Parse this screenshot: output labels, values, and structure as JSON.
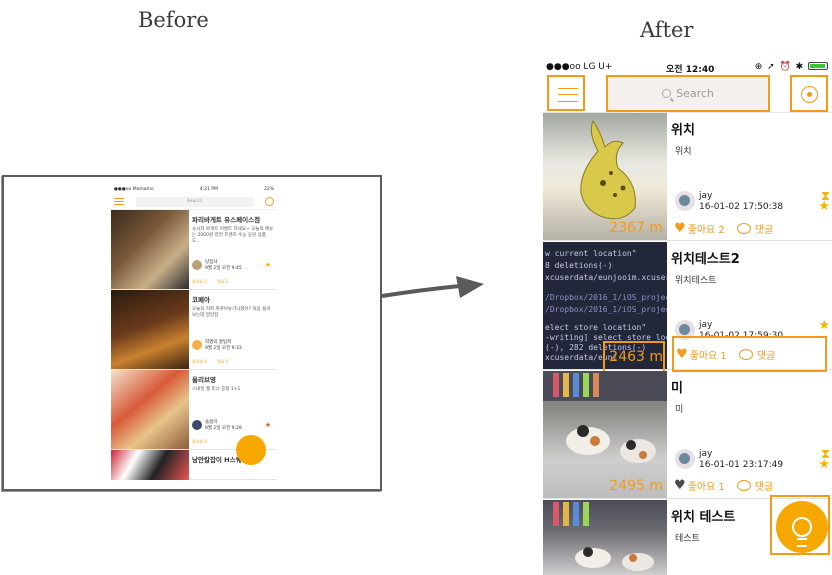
{
  "captions": {
    "before": "Before",
    "after": "After"
  },
  "before": {
    "status": {
      "carrier": "●●●oo Mamamo",
      "time": "4:21 PM",
      "battery": "22%"
    },
    "search_placeholder": "Search",
    "items": [
      {
        "title": "파리바게트 유스페이스점",
        "desc": "소시지 바게트 이벤트 하네요~ 오늘의 메뉴는 2000원 라떤 프렌즈 수능 응원 상품도...",
        "user": "냥집사",
        "date": "9월 2일 오전 9:45",
        "like": "좋아요 2",
        "comment": "댓글 1"
      },
      {
        "title": "코페아",
        "desc": "오늘의 커피 파푸아뉴기니였어? 처음 들어보는데 달달함",
        "user": "익명의 꿀팁퍼",
        "date": "9월 2일 오전 9:33",
        "like": "좋아요 4",
        "comment": "댓글 0"
      },
      {
        "title": "올리브영",
        "desc": "스네일 젤 토너 증정 1+1",
        "user": "솔몸이",
        "date": "9월 2일 오전 9:29",
        "like": "좋아요 3",
        "comment": ""
      },
      {
        "title": "낭만칼잡이 H스퀘어",
        "desc": "",
        "user": "",
        "date": "",
        "like": "",
        "comment": ""
      }
    ]
  },
  "after": {
    "status": {
      "carrier": "●●●oo LG U+",
      "time": "오전 12:40",
      "icons": "⊕ ➚ ⏰ ✱"
    },
    "search_placeholder": "Search",
    "items": [
      {
        "title": "위치",
        "desc": "위치",
        "distance": "2367 m",
        "user": "jay",
        "datetime": "16-01-02 17:50:38",
        "like": "좋아요 2",
        "comment": "댓글",
        "liked": true
      },
      {
        "title": "위치테스트2",
        "desc": "위치테스트",
        "distance": "2463 m",
        "user": "jay",
        "datetime": "16-01-02 17:59:30",
        "like": "좋아요 1",
        "comment": "댓글",
        "liked": true
      },
      {
        "title": "미",
        "desc": "미",
        "distance": "2495 m",
        "user": "jay",
        "datetime": "16-01-01 23:17:49",
        "like": "좋아요 1",
        "comment": "댓글",
        "liked": false
      },
      {
        "title": "위치 테스트",
        "desc": "테스트",
        "distance": "",
        "user": "",
        "datetime": "",
        "like": "",
        "comment": "",
        "liked": false
      }
    ],
    "colors": {
      "accent": "#f39a1b",
      "fab": "#f6a800",
      "star": "#f6b400"
    }
  }
}
